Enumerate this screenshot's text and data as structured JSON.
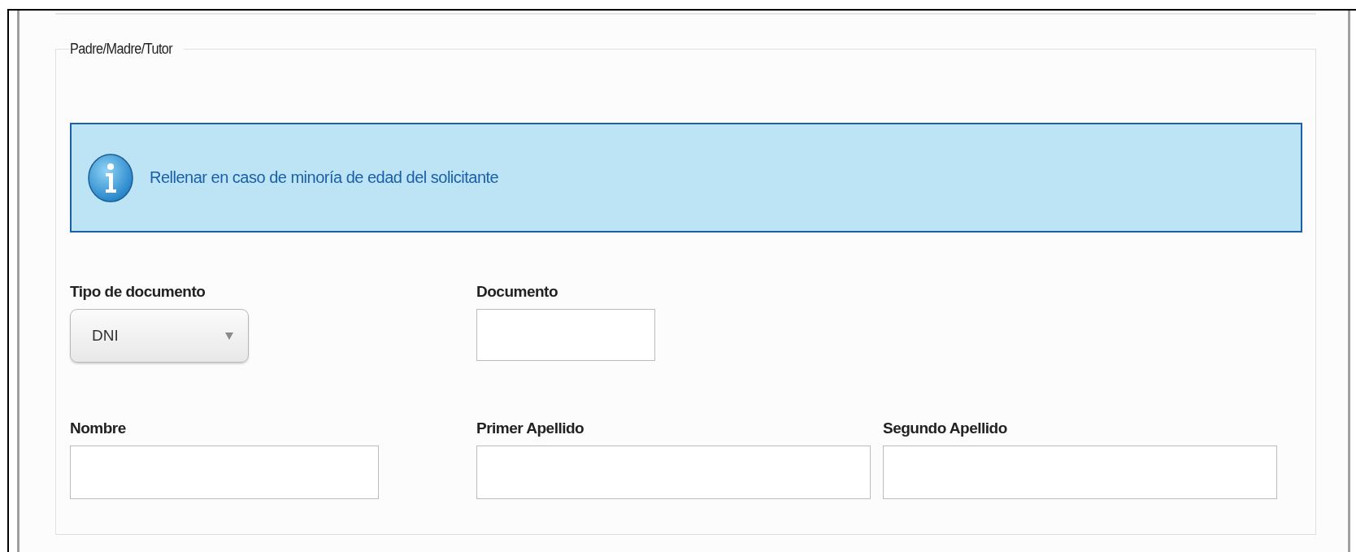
{
  "fieldset": {
    "legend": "Padre/Madre/Tutor"
  },
  "info": {
    "message": "Rellenar en caso de minoría de edad del solicitante"
  },
  "rows": [
    {
      "fields": [
        {
          "kind": "select",
          "label": "Tipo de documento",
          "value": "DNI"
        },
        {
          "kind": "text",
          "label": "Documento"
        }
      ]
    },
    {
      "fields": [
        {
          "kind": "text",
          "label": "Nombre"
        },
        {
          "kind": "text",
          "label": "Primer Apellido"
        },
        {
          "kind": "text",
          "label": "Segundo Apellido"
        }
      ]
    }
  ]
}
